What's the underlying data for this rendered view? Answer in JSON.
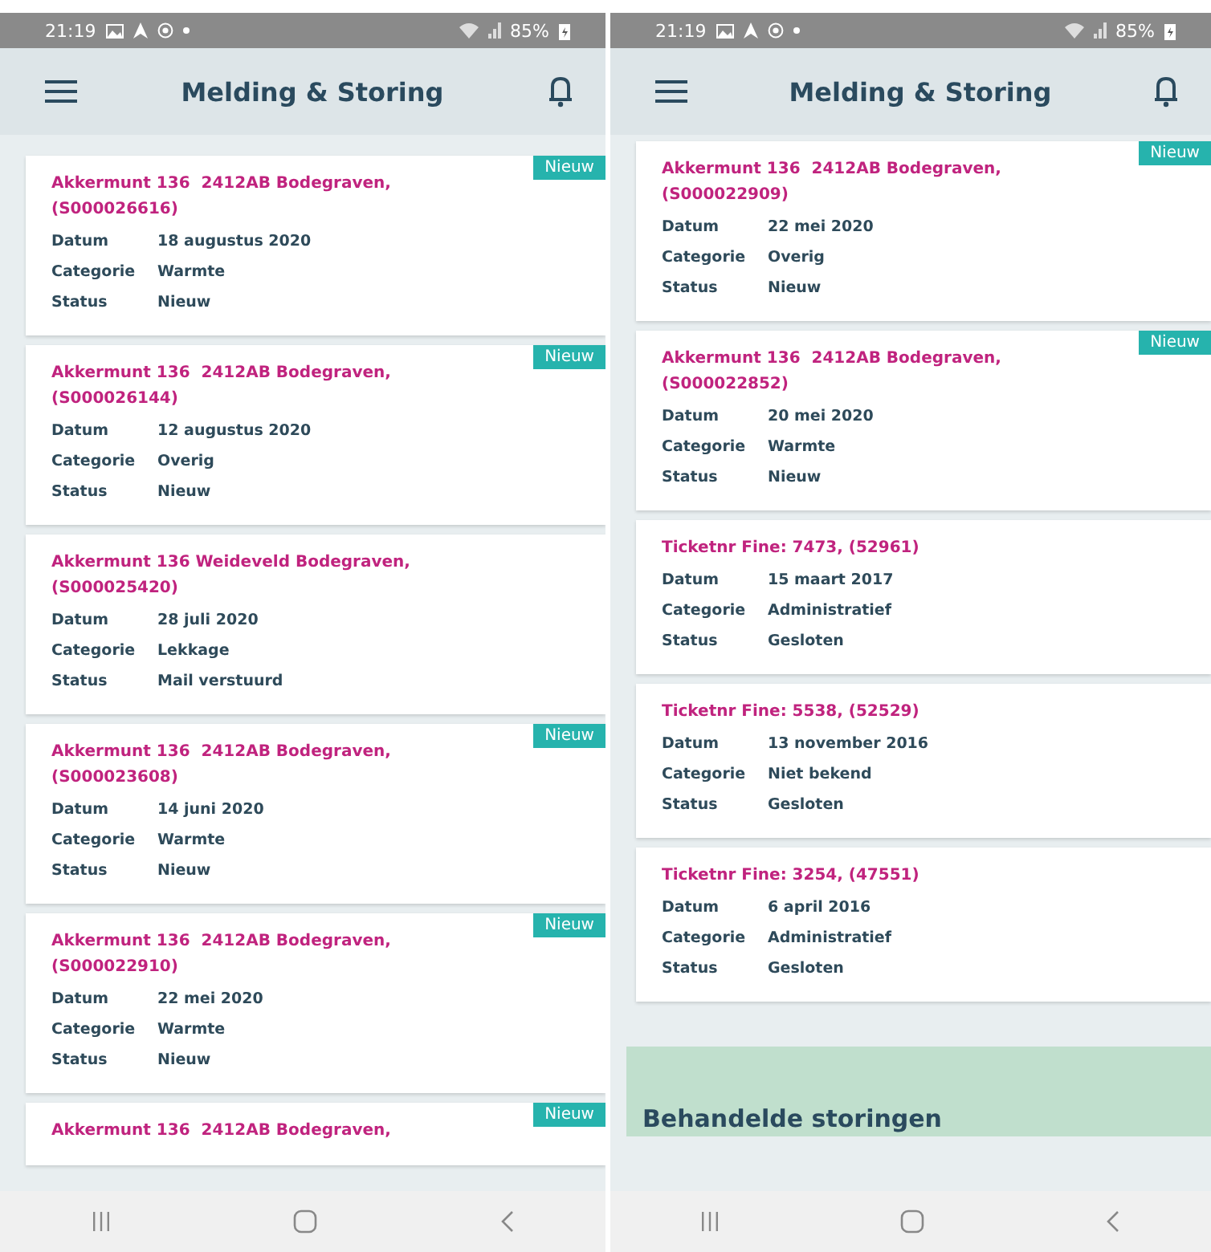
{
  "screens": [
    {
      "status_bar": {
        "time": "21:19",
        "battery": "85%"
      },
      "header": {
        "title": "Melding & Storing"
      },
      "cards": [
        {
          "title": "Akkermunt 136  2412AB Bodegraven, (S000026616)",
          "badge": "Nieuw",
          "fields": [
            {
              "label": "Datum",
              "value": "18 augustus 2020"
            },
            {
              "label": "Categorie",
              "value": "Warmte"
            },
            {
              "label": "Status",
              "value": "Nieuw"
            }
          ]
        },
        {
          "title": "Akkermunt 136  2412AB Bodegraven, (S000026144)",
          "badge": "Nieuw",
          "fields": [
            {
              "label": "Datum",
              "value": "12 augustus 2020"
            },
            {
              "label": "Categorie",
              "value": "Overig"
            },
            {
              "label": "Status",
              "value": "Nieuw"
            }
          ]
        },
        {
          "title": "Akkermunt 136 Weideveld Bodegraven, (S000025420)",
          "fields": [
            {
              "label": "Datum",
              "value": "28 juli 2020"
            },
            {
              "label": "Categorie",
              "value": "Lekkage"
            },
            {
              "label": "Status",
              "value": "Mail verstuurd"
            }
          ]
        },
        {
          "title": "Akkermunt 136  2412AB Bodegraven, (S000023608)",
          "badge": "Nieuw",
          "fields": [
            {
              "label": "Datum",
              "value": "14 juni 2020"
            },
            {
              "label": "Categorie",
              "value": "Warmte"
            },
            {
              "label": "Status",
              "value": "Nieuw"
            }
          ]
        },
        {
          "title": "Akkermunt 136  2412AB Bodegraven, (S000022910)",
          "badge": "Nieuw",
          "fields": [
            {
              "label": "Datum",
              "value": "22 mei 2020"
            },
            {
              "label": "Categorie",
              "value": "Warmte"
            },
            {
              "label": "Status",
              "value": "Nieuw"
            }
          ]
        },
        {
          "title": "Akkermunt 136  2412AB Bodegraven,",
          "badge": "Nieuw"
        }
      ]
    },
    {
      "status_bar": {
        "time": "21:19",
        "battery": "85%"
      },
      "header": {
        "title": "Melding & Storing"
      },
      "cards": [
        {
          "title": "Akkermunt 136  2412AB Bodegraven, (S000022909)",
          "badge": "Nieuw",
          "fields": [
            {
              "label": "Datum",
              "value": "22 mei 2020"
            },
            {
              "label": "Categorie",
              "value": "Overig"
            },
            {
              "label": "Status",
              "value": "Nieuw"
            }
          ]
        },
        {
          "title": "Akkermunt 136  2412AB Bodegraven, (S000022852)",
          "badge": "Nieuw",
          "fields": [
            {
              "label": "Datum",
              "value": "20 mei 2020"
            },
            {
              "label": "Categorie",
              "value": "Warmte"
            },
            {
              "label": "Status",
              "value": "Nieuw"
            }
          ]
        },
        {
          "title": "Ticketnr Fine: 7473, (52961)",
          "fields": [
            {
              "label": "Datum",
              "value": "15 maart 2017"
            },
            {
              "label": "Categorie",
              "value": "Administratief"
            },
            {
              "label": "Status",
              "value": "Gesloten"
            }
          ]
        },
        {
          "title": "Ticketnr Fine: 5538, (52529)",
          "fields": [
            {
              "label": "Datum",
              "value": "13 november 2016"
            },
            {
              "label": "Categorie",
              "value": "Niet bekend"
            },
            {
              "label": "Status",
              "value": "Gesloten"
            }
          ]
        },
        {
          "title": "Ticketnr Fine: 3254, (47551)",
          "fields": [
            {
              "label": "Datum",
              "value": "6 april 2016"
            },
            {
              "label": "Categorie",
              "value": "Administratief"
            },
            {
              "label": "Status",
              "value": "Gesloten"
            }
          ]
        }
      ],
      "section": {
        "title": "Behandelde storingen"
      }
    }
  ]
}
